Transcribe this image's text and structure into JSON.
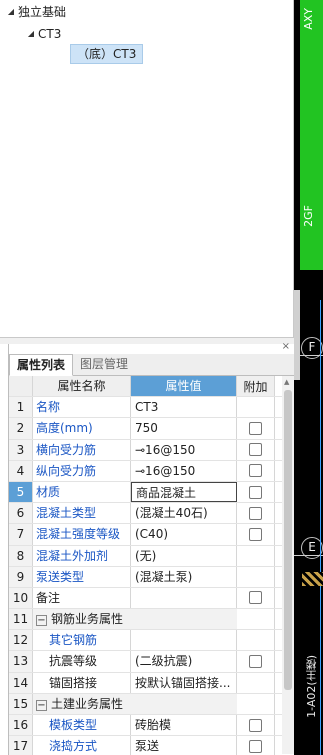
{
  "tree": {
    "root": "独立基础",
    "child": "CT3",
    "leaf": "（底）CT3"
  },
  "panel": {
    "close": "×",
    "tabs": [
      "属性列表",
      "图层管理"
    ]
  },
  "grid": {
    "headers": {
      "name": "属性名称",
      "value": "属性值",
      "add": "附加"
    },
    "rows": [
      {
        "n": "1",
        "name": "名称",
        "value": "CT3",
        "blue": true,
        "check": false
      },
      {
        "n": "2",
        "name": "高度(mm)",
        "value": "750",
        "blue": true,
        "check": true
      },
      {
        "n": "3",
        "name": "横向受力筋",
        "value": "⊸16@150",
        "blue": true,
        "check": true
      },
      {
        "n": "4",
        "name": "纵向受力筋",
        "value": "⊸16@150",
        "blue": true,
        "check": true
      },
      {
        "n": "5",
        "name": "材质",
        "value": "商品混凝土",
        "blue": true,
        "check": true,
        "selected": true
      },
      {
        "n": "6",
        "name": "混凝土类型",
        "value": "(混凝土40石)",
        "blue": true,
        "check": true
      },
      {
        "n": "7",
        "name": "混凝土强度等级",
        "value": "(C40)",
        "blue": true,
        "check": true
      },
      {
        "n": "8",
        "name": "混凝土外加剂",
        "value": "(无)",
        "blue": true,
        "check": false
      },
      {
        "n": "9",
        "name": "泵送类型",
        "value": "(混凝土泵)",
        "blue": true,
        "check": false
      },
      {
        "n": "10",
        "name": "备注",
        "value": "",
        "blue": false,
        "check": true
      },
      {
        "n": "11",
        "name": "钢筋业务属性",
        "group": true
      },
      {
        "n": "12",
        "name": "其它钢筋",
        "value": "",
        "blue": true,
        "indent": true,
        "check": false
      },
      {
        "n": "13",
        "name": "抗震等级",
        "value": "(二级抗震)",
        "blue": false,
        "indent": true,
        "check": true
      },
      {
        "n": "14",
        "name": "锚固搭接",
        "value": "按默认锚固搭接...",
        "blue": false,
        "indent": true,
        "check": false
      },
      {
        "n": "15",
        "name": "土建业务属性",
        "group": true
      },
      {
        "n": "16",
        "name": "模板类型",
        "value": "砖胎模",
        "blue": true,
        "indent": true,
        "check": true
      },
      {
        "n": "17",
        "name": "浇捣方式",
        "value": "泵送",
        "blue": true,
        "indent": true,
        "check": true
      }
    ]
  },
  "drawing": {
    "top_text": "AΧY",
    "mid_text": "2GF",
    "axis_f": "F",
    "axis_e": "E",
    "bottom_text": "1-A02(主楼)",
    "colors": {
      "background": "#000000",
      "green": "#22c422",
      "accent": "#5c9fd6"
    }
  }
}
